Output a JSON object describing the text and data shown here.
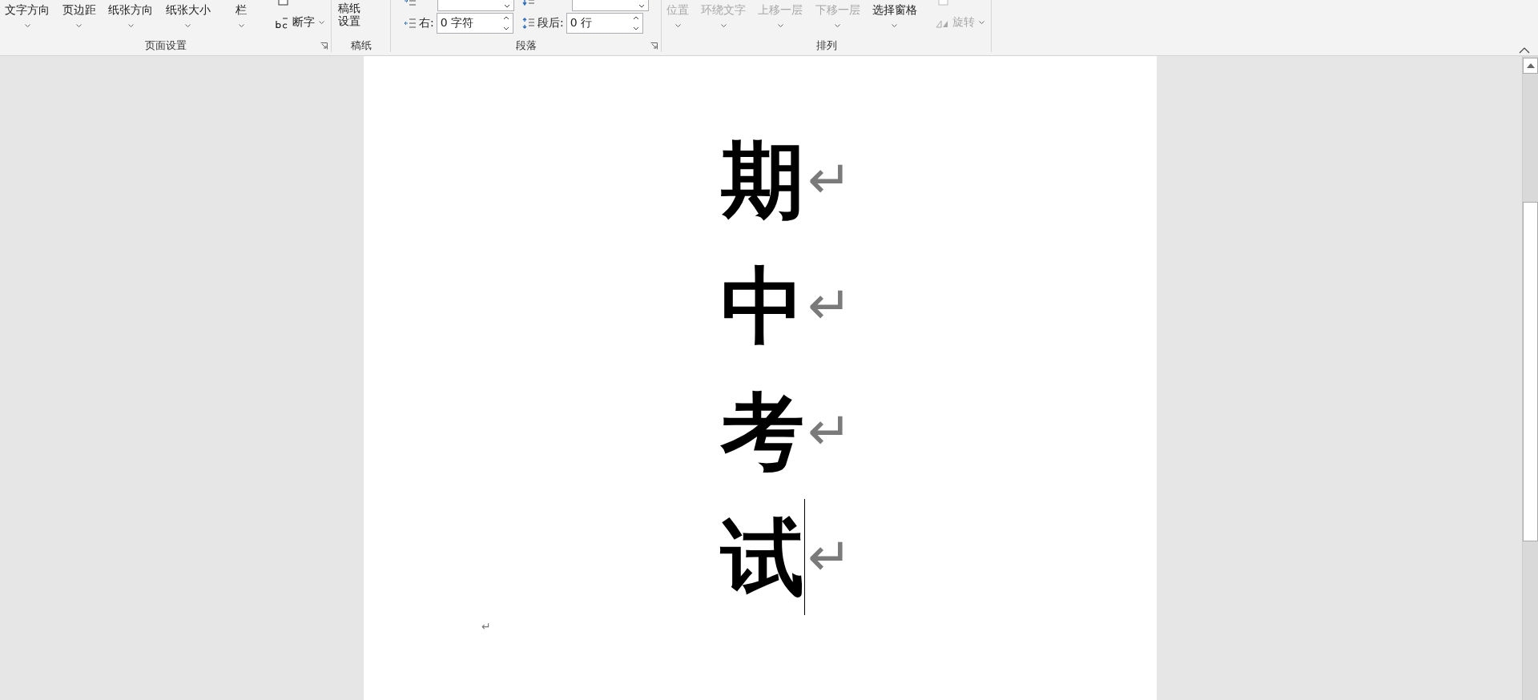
{
  "ribbon": {
    "groups": [
      {
        "kind": "page_setup",
        "label": "页面设置",
        "buttons": [
          {
            "label": "文字方向"
          },
          {
            "label": "页边距"
          },
          {
            "label": "纸张方向"
          },
          {
            "label": "纸张大小"
          },
          {
            "label": "栏"
          }
        ],
        "side_items": [
          {
            "label": "断字"
          }
        ]
      },
      {
        "kind": "manuscript",
        "label": "稿纸",
        "buttons": [
          {
            "label": "稿纸设置"
          }
        ]
      },
      {
        "kind": "paragraph",
        "label": "段落",
        "fields": [
          {
            "label": "右:",
            "value": "0 字符"
          },
          {
            "label": "段后:",
            "value": "0 行"
          }
        ]
      },
      {
        "kind": "arrange",
        "label": "排列",
        "buttons": [
          {
            "label": "位置",
            "disabled": true
          },
          {
            "label": "环绕文字",
            "disabled": true
          },
          {
            "label": "上移一层",
            "disabled": true
          },
          {
            "label": "下移一层",
            "disabled": true
          },
          {
            "label": "选择窗格",
            "disabled": false
          }
        ],
        "side_items": [
          {
            "label": "旋转",
            "disabled": true
          }
        ]
      }
    ]
  },
  "document": {
    "lines": [
      {
        "text": "期",
        "mark": "↵",
        "cursor": false
      },
      {
        "text": "中",
        "mark": "↵",
        "cursor": false
      },
      {
        "text": "考",
        "mark": "↵",
        "cursor": false
      },
      {
        "text": "试",
        "mark": "↵",
        "cursor": true
      }
    ],
    "trailing_mark": "↵"
  }
}
